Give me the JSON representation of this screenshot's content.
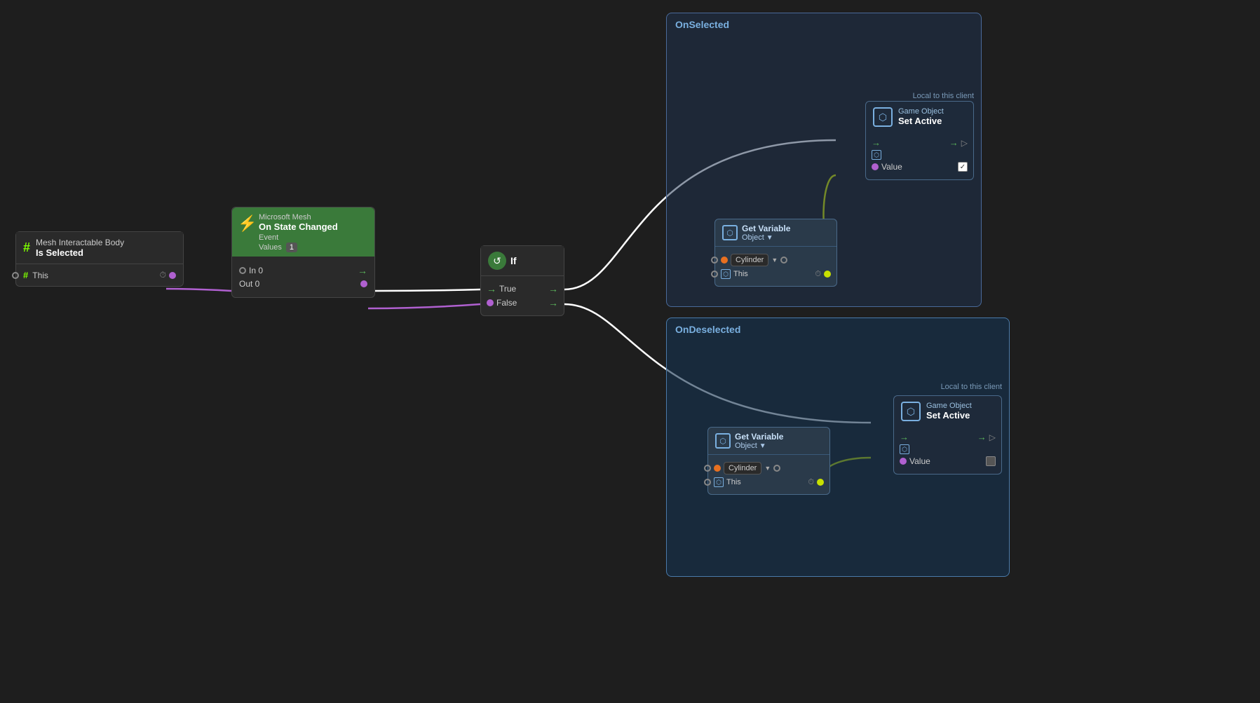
{
  "nodes": {
    "meshInteractable": {
      "title": "Mesh Interactable Body",
      "subtitle": "Is Selected",
      "portLabel": "This"
    },
    "onStateChanged": {
      "topLabel": "Microsoft Mesh",
      "mainTitle": "On State Changed",
      "eventLabel": "Event",
      "valuesLabel": "Values",
      "valuesBadge": "1",
      "inPortLabel": "In 0",
      "outPortLabel": "Out 0"
    },
    "ifNode": {
      "title": "If",
      "trueLabel": "True",
      "falseLabel": "False"
    },
    "onSelected": {
      "containerLabel": "OnSelected",
      "localToClient": "Local to this client",
      "getVar": {
        "title": "Get Variable",
        "objectLabel": "Object",
        "cylinderLabel": "Cylinder",
        "thisLabel": "This"
      },
      "gameObjectSetActive": {
        "title": "Game Object",
        "subtitle": "Set Active",
        "valueLabel": "Value"
      }
    },
    "onDeselected": {
      "containerLabel": "OnDeselected",
      "localToClient": "Local to this client",
      "getVar": {
        "title": "Get Variable",
        "objectLabel": "Object",
        "cylinderLabel": "Cylinder",
        "thisLabel": "This"
      },
      "gameObjectSetActive": {
        "title": "Game Object",
        "subtitle": "Set Active",
        "valueLabel": "Value"
      }
    }
  },
  "colors": {
    "background": "#1e1e1e",
    "nodeBackground": "#2a2a2a",
    "greenHeader": "#3a7a3a",
    "containerBg": "rgba(30,50,80,0.5)",
    "containerBorder": "#4a6a9a",
    "portPurple": "#b060d0",
    "portGreen": "#5cb85c",
    "portOrange": "#e87020",
    "portYellowGreen": "#c8e000",
    "portWhite": "#888888",
    "connectionWhite": "#ffffff",
    "connectionGreen": "#90d020"
  }
}
